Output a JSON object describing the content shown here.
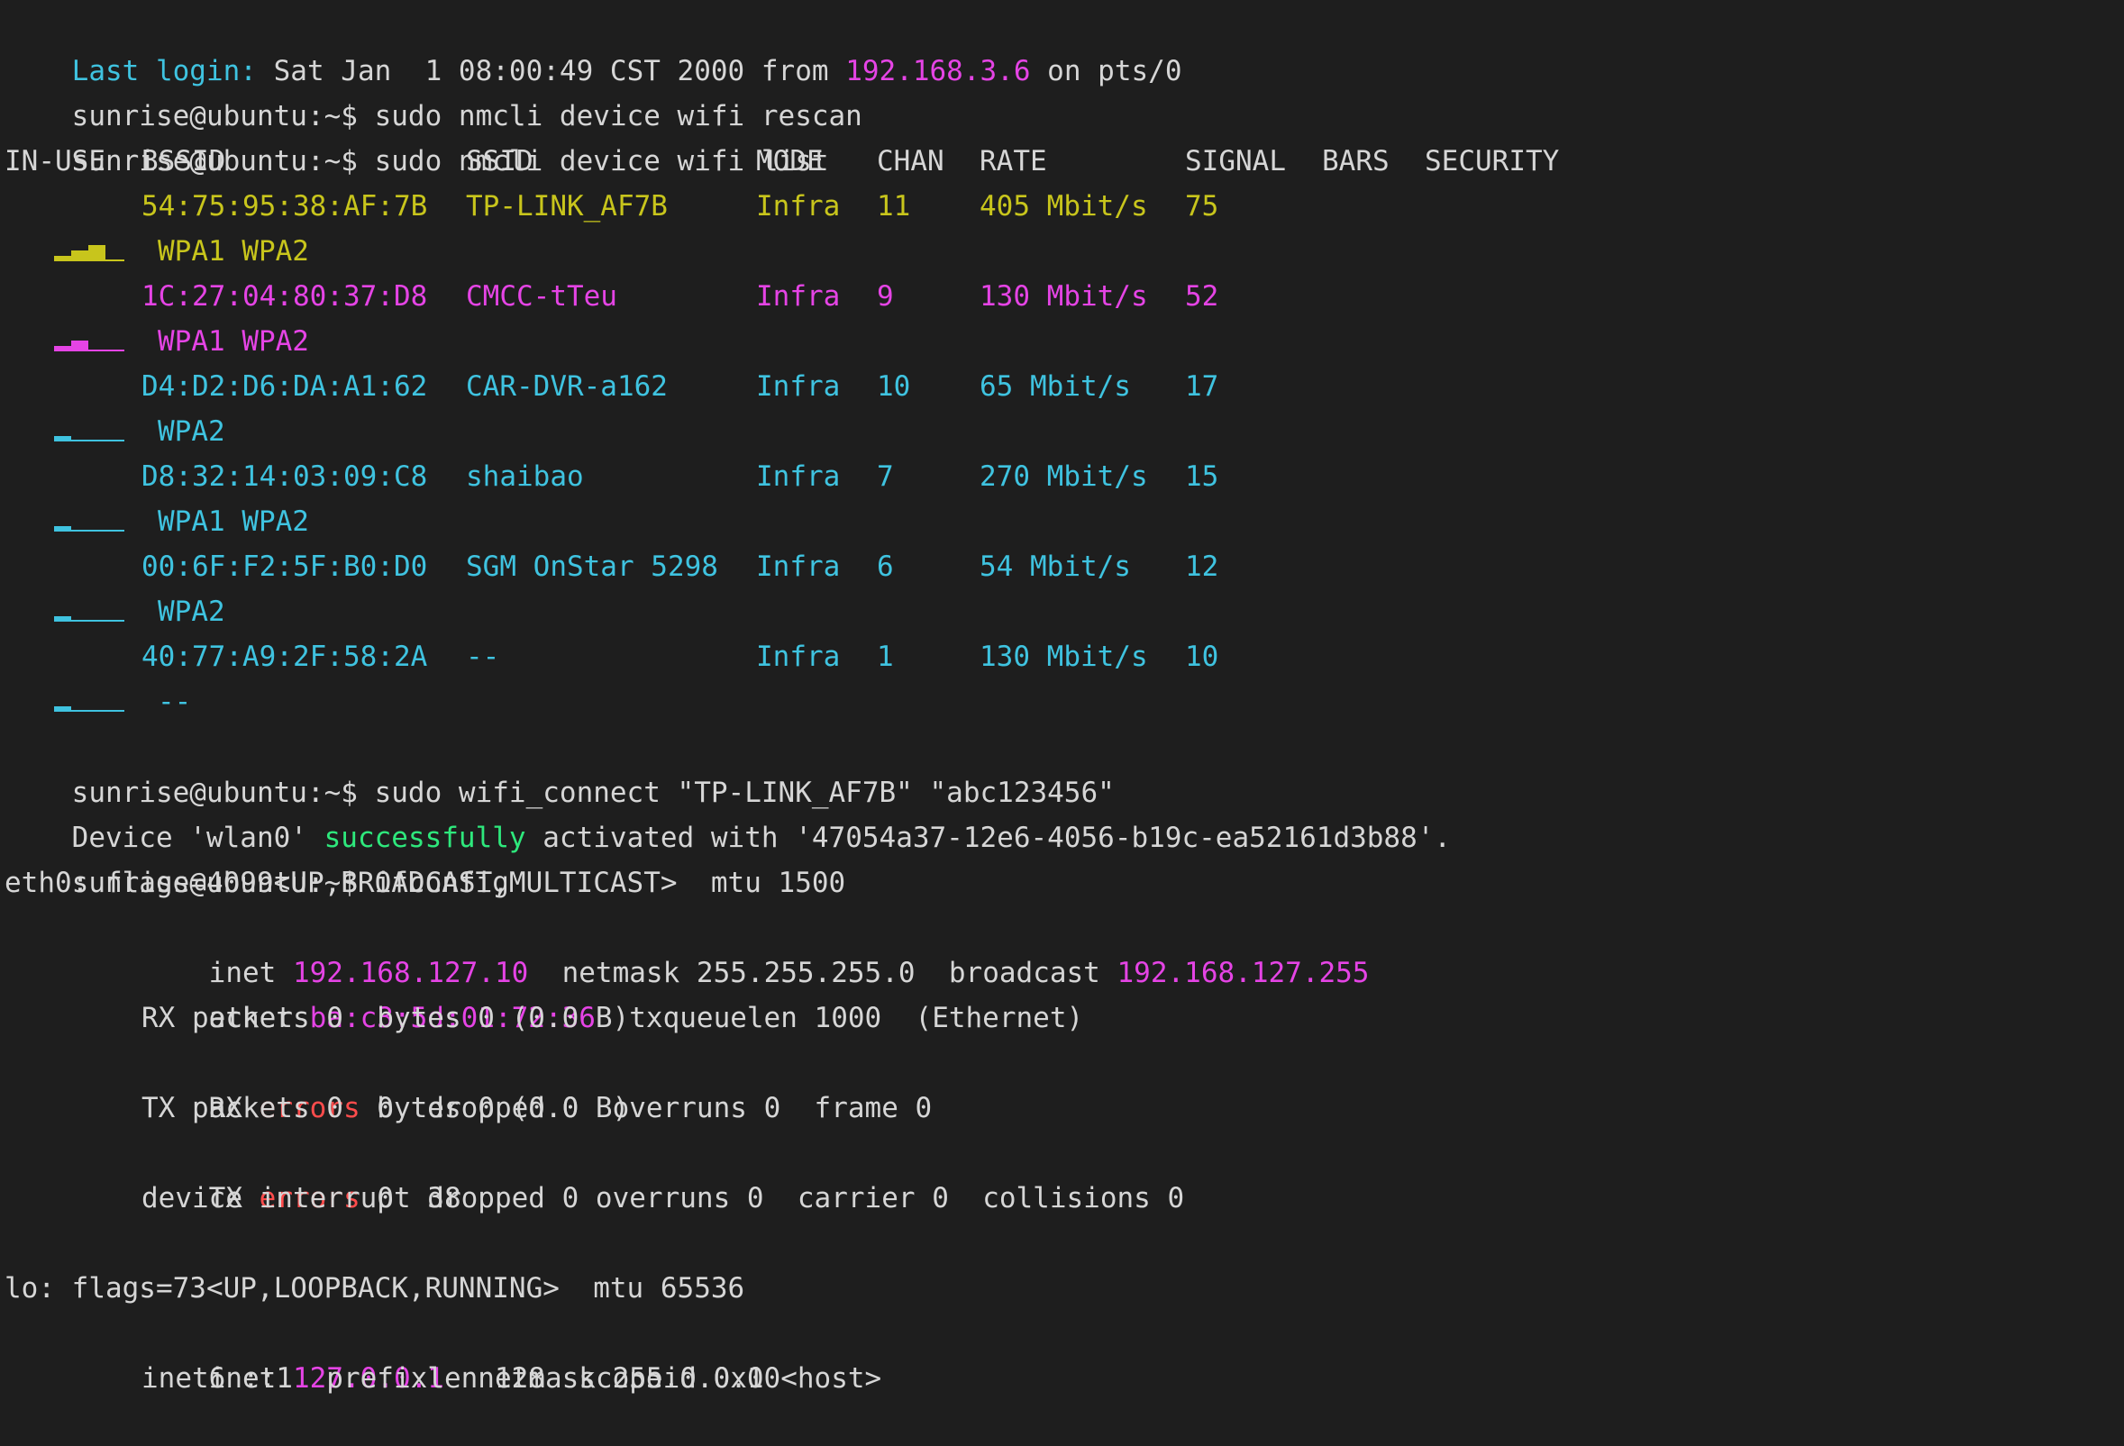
{
  "login": {
    "prefix": "Last login:",
    "date": " Sat Jan  1 08:00:49 CST 2000 from ",
    "ip": "192.168.3.6",
    "suffix": " on pts/0"
  },
  "prompt": "sunrise@ubuntu:~$",
  "commands": {
    "rescan": " sudo nmcli device wifi rescan",
    "list": " sudo nmcli device wifi list",
    "connect": " sudo wifi_connect \"TP-LINK_AF7B\" \"abc123456\"",
    "ifconfig": " ifconfig"
  },
  "wifi_table": {
    "headers": [
      "IN-USE",
      "BSSID",
      "SSID",
      "MODE",
      "CHAN",
      "RATE",
      "SIGNAL",
      "BARS",
      "SECURITY"
    ],
    "rows": [
      {
        "bssid": "54:75:95:38:AF:7B",
        "ssid": "TP-LINK_AF7B",
        "mode": "Infra",
        "chan": "11",
        "rate": "405 Mbit/s",
        "signal": "75",
        "security": "WPA1 WPA2",
        "bars": 3,
        "color": "#c8c51c"
      },
      {
        "bssid": "1C:27:04:80:37:D8",
        "ssid": "CMCC-tTeu",
        "mode": "Infra",
        "chan": "9",
        "rate": "130 Mbit/s",
        "signal": "52",
        "security": "WPA1 WPA2",
        "bars": 2,
        "color": "#e544e5"
      },
      {
        "bssid": "D4:D2:D6:DA:A1:62",
        "ssid": "CAR-DVR-a162",
        "mode": "Infra",
        "chan": "10",
        "rate": "65 Mbit/s",
        "signal": "17",
        "security": "WPA2",
        "bars": 1,
        "color": "#3fc3e0"
      },
      {
        "bssid": "D8:32:14:03:09:C8",
        "ssid": "shaibao",
        "mode": "Infra",
        "chan": "7",
        "rate": "270 Mbit/s",
        "signal": "15",
        "security": "WPA1 WPA2",
        "bars": 1,
        "color": "#3fc3e0"
      },
      {
        "bssid": "00:6F:F2:5F:B0:D0",
        "ssid": "SGM OnStar 5298",
        "mode": "Infra",
        "chan": "6",
        "rate": "54 Mbit/s",
        "signal": "12",
        "security": "WPA2",
        "bars": 1,
        "color": "#3fc3e0"
      },
      {
        "bssid": "40:77:A9:2F:58:2A",
        "ssid": "--",
        "mode": "Infra",
        "chan": "1",
        "rate": "130 Mbit/s",
        "signal": "10",
        "security": "--",
        "bars": 1,
        "color": "#3fc3e0"
      }
    ]
  },
  "activation": {
    "pre": "Device 'wlan0' ",
    "word": "successfully",
    "post": " activated with '47054a37-12e6-4056-b19c-ea52161d3b88'."
  },
  "eth0": {
    "header": "eth0: flags=4099<UP,BROADCAST,MULTICAST>  mtu 1500",
    "inet_label": "inet ",
    "inet": "192.168.127.10",
    "netmask_part": "  netmask 255.255.255.0  broadcast ",
    "broadcast": "192.168.127.255",
    "ether_label": "ether ",
    "ether": "ba:c3:5d:01:72:36",
    "ether_rest": "  txqueuelen 1000  (Ethernet)",
    "rx_packets": "RX packets 0  bytes 0 (0.0 B)",
    "rx_err_pre": "RX ",
    "errors_word": "errors",
    "rx_err_post": " 0  dropped 0  overruns 0  frame 0",
    "tx_packets": "TX packets 0  bytes 0 (0.0 B)",
    "tx_err_pre": "TX ",
    "tx_err_post": " 0  dropped 0 overruns 0  carrier 0  collisions 0",
    "interrupt": "device interrupt 38"
  },
  "lo": {
    "header": "lo: flags=73<UP,LOOPBACK,RUNNING>  mtu 65536",
    "inet_label": "inet ",
    "inet": "127.0.0.1",
    "netmask_part": "  netmask 255.0.0.0",
    "inet6": "inet6 ::1  prefixlen 128  scopeid 0x10<host>"
  },
  "colors": {
    "background": "#1e1e1e",
    "text": "#d6d6d6",
    "blue": "#3fc3e0",
    "magenta": "#e544e5",
    "yellow": "#c8c51c",
    "green": "#2ee87c",
    "red": "#ff4c4c"
  }
}
